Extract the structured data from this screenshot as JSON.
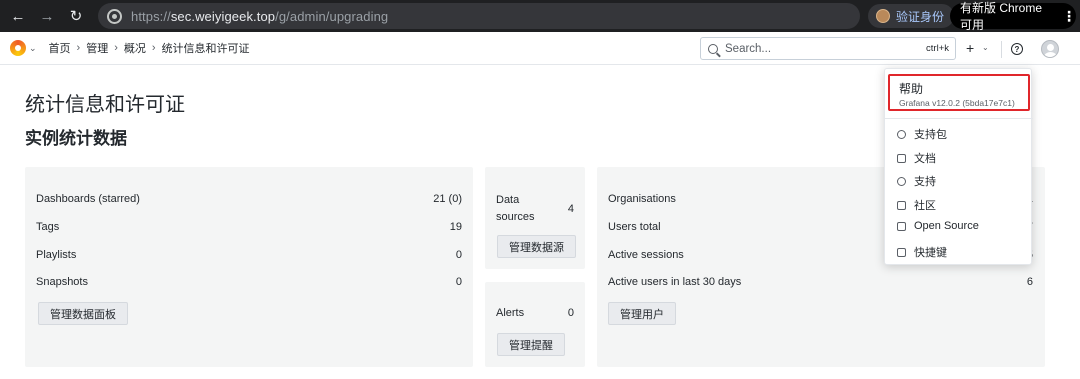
{
  "browser": {
    "back_glyph": "←",
    "forward_glyph": "→",
    "reload_glyph": "↻",
    "url_prefix": "https://",
    "url_host": "sec.weiyigeek.top",
    "url_path": "/g/admin/upgrading",
    "verify_label": "验证身份",
    "update_label": "有新版 Chrome 可用",
    "kebab": "⋮"
  },
  "topbar": {
    "breadcrumb": [
      "首页",
      "管理",
      "概况",
      "统计信息和许可证"
    ],
    "search_placeholder": "Search...",
    "search_shortcut": "ctrl+k",
    "plus": "+",
    "help_glyph": "?"
  },
  "page": {
    "title": "统计信息和许可证",
    "section_title": "实例统计数据"
  },
  "cards": {
    "dashboards": {
      "rows": [
        {
          "label": "Dashboards (starred)",
          "value": "21 (0)"
        },
        {
          "label": "Tags",
          "value": "19"
        },
        {
          "label": "Playlists",
          "value": "0"
        },
        {
          "label": "Snapshots",
          "value": "0"
        }
      ],
      "button": "管理数据面板"
    },
    "datasources": {
      "label": "Data sources",
      "value": "4",
      "button": "管理数据源"
    },
    "alerts": {
      "label": "Alerts",
      "value": "0",
      "button": "管理提醒"
    },
    "users": {
      "rows": [
        {
          "label": "Organisations",
          "value": "1"
        },
        {
          "label": "Users total",
          "value": "7"
        },
        {
          "label": "Active sessions",
          "value": "5"
        },
        {
          "label": "Active users in last 30 days",
          "value": "6"
        }
      ],
      "button": "管理用户"
    }
  },
  "help_menu": {
    "title": "帮助",
    "version": "Grafana v12.0.2 (5bda17e7c1)",
    "items": [
      "支持包",
      "文档",
      "支持",
      "社区",
      "Open Source",
      "快捷键"
    ]
  },
  "colors": {
    "highlight": "#e0262b",
    "card_bg": "#f4f5f5",
    "chrome_bg": "#1f2022"
  }
}
